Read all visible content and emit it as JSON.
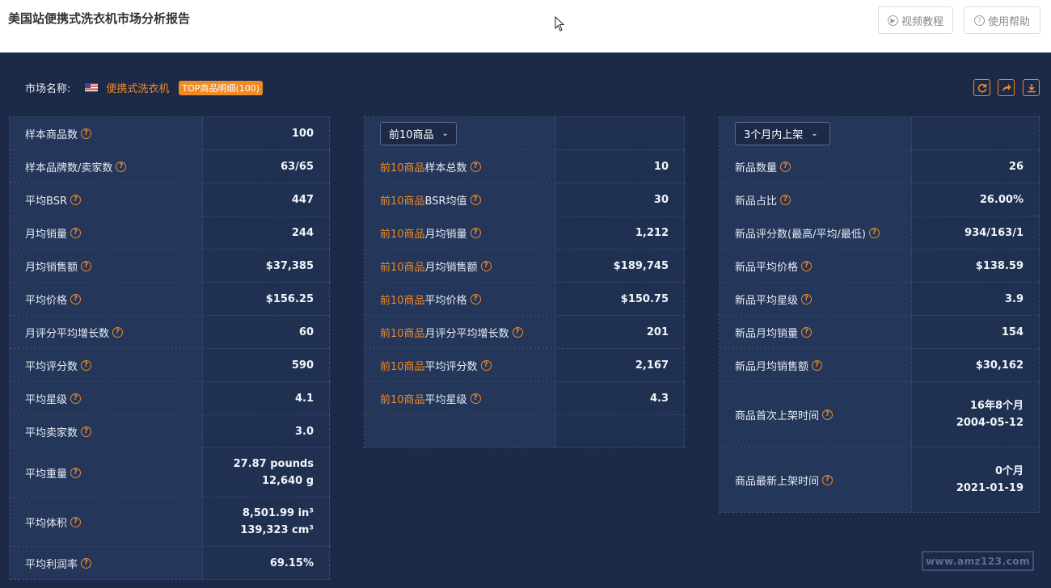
{
  "header": {
    "title": "美国站便携式洗衣机市场分析报告",
    "video_btn": "视频教程",
    "help_btn": "使用帮助"
  },
  "market": {
    "label": "市场名称:",
    "name": "便携式洗衣机",
    "badge": "TOP商品明细(100)"
  },
  "col1": {
    "rows": [
      {
        "label": "样本商品数",
        "value": "100"
      },
      {
        "label": "样本品牌数/卖家数",
        "value": "63/65"
      },
      {
        "label": "平均BSR",
        "value": "447"
      },
      {
        "label": "月均销量",
        "value": "244"
      },
      {
        "label": "月均销售额",
        "value": "$37,385"
      },
      {
        "label": "平均价格",
        "value": "$156.25"
      },
      {
        "label": "月评分平均增长数",
        "value": "60"
      },
      {
        "label": "平均评分数",
        "value": "590"
      },
      {
        "label": "平均星级",
        "value": "4.1"
      },
      {
        "label": "平均卖家数",
        "value": "3.0"
      },
      {
        "label": "平均重量",
        "value": "27.87 pounds",
        "value2": "12,640 g"
      },
      {
        "label": "平均体积",
        "value": "8,501.99 in³",
        "value2": "139,323 cm³"
      },
      {
        "label": "平均利润率",
        "value": "69.15%"
      }
    ]
  },
  "col2": {
    "select": "前10商品",
    "prefix": "前10商品",
    "rows": [
      {
        "label": "样本总数",
        "value": "10"
      },
      {
        "label": "BSR均值",
        "value": "30"
      },
      {
        "label": "月均销量",
        "value": "1,212"
      },
      {
        "label": "月均销售额",
        "value": "$189,745"
      },
      {
        "label": "平均价格",
        "value": "$150.75"
      },
      {
        "label": "月评分平均增长数",
        "value": "201"
      },
      {
        "label": "平均评分数",
        "value": "2,167"
      },
      {
        "label": "平均星级",
        "value": "4.3"
      }
    ]
  },
  "col3": {
    "select": "3个月内上架",
    "rows": [
      {
        "label": "新品数量",
        "value": "26"
      },
      {
        "label": "新品占比",
        "value": "26.00%"
      },
      {
        "label": "新品评分数(最高/平均/最低)",
        "value": "934/163/1"
      },
      {
        "label": "新品平均价格",
        "value": "$138.59"
      },
      {
        "label": "新品平均星级",
        "value": "3.9"
      },
      {
        "label": "新品月均销量",
        "value": "154"
      },
      {
        "label": "新品月均销售额",
        "value": "$30,162"
      },
      {
        "label": "商品首次上架时间",
        "value": "16年8个月",
        "value2": "2004-05-12"
      },
      {
        "label": "商品最新上架时间",
        "value": "0个月",
        "value2": "2021-01-19"
      }
    ]
  },
  "watermark": "www.amz123.com",
  "colors": {
    "accent": "#f08a24",
    "background": "#1c2947"
  }
}
